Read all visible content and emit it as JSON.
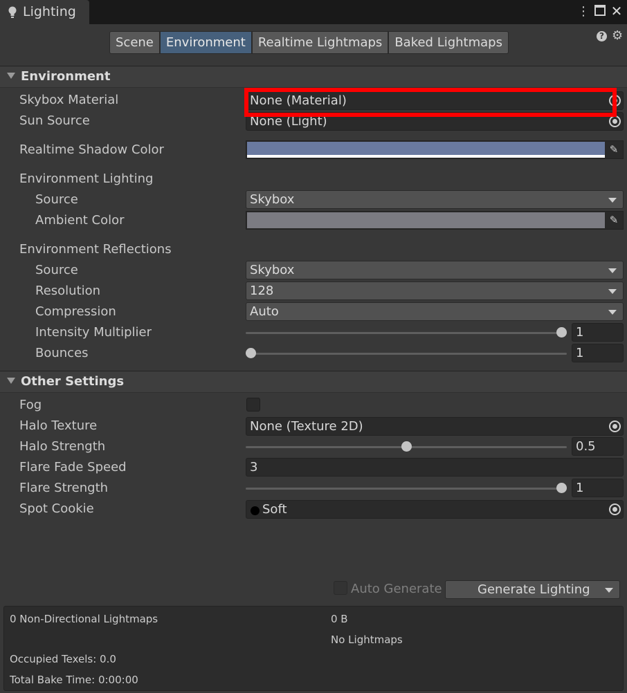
{
  "window": {
    "tab_title": "Lighting",
    "icons": [
      "lightbulb-icon",
      "kebab-menu-icon",
      "maximize-icon",
      "close-icon"
    ]
  },
  "toolbar": {
    "tabs": [
      "Scene",
      "Environment",
      "Realtime Lightmaps",
      "Baked Lightmaps"
    ],
    "active_tab": "Environment",
    "help_glyph": "?",
    "settings_glyph": "⚙"
  },
  "environment": {
    "header": "Environment",
    "skybox_material": {
      "label": "Skybox Material",
      "value": "None (Material)"
    },
    "sun_source": {
      "label": "Sun Source",
      "value": "None (Light)"
    },
    "realtime_shadow_color": {
      "label": "Realtime Shadow Color",
      "color": "#6a7aa0"
    },
    "environment_lighting": {
      "label": "Environment Lighting",
      "source": {
        "label": "Source",
        "value": "Skybox"
      },
      "ambient_color": {
        "label": "Ambient Color",
        "color": "#7b7b82"
      }
    },
    "environment_reflections": {
      "label": "Environment Reflections",
      "source": {
        "label": "Source",
        "value": "Skybox"
      },
      "resolution": {
        "label": "Resolution",
        "value": "128"
      },
      "compression": {
        "label": "Compression",
        "value": "Auto"
      },
      "intensity_multiplier": {
        "label": "Intensity Multiplier",
        "value": "1",
        "fraction": 1.0
      },
      "bounces": {
        "label": "Bounces",
        "value": "1",
        "fraction": 0.0
      }
    }
  },
  "other_settings": {
    "header": "Other Settings",
    "fog": {
      "label": "Fog",
      "checked": false
    },
    "halo_texture": {
      "label": "Halo Texture",
      "value": "None (Texture 2D)"
    },
    "halo_strength": {
      "label": "Halo Strength",
      "value": "0.5",
      "fraction": 0.5
    },
    "flare_fade_speed": {
      "label": "Flare Fade Speed",
      "value": "3"
    },
    "flare_strength": {
      "label": "Flare Strength",
      "value": "1",
      "fraction": 1.0
    },
    "spot_cookie": {
      "label": "Spot Cookie",
      "value": "Soft"
    }
  },
  "bake": {
    "auto_generate": {
      "label": "Auto Generate",
      "checked": false
    },
    "generate_button": "Generate Lighting"
  },
  "stats": {
    "lightmaps": "0 Non-Directional Lightmaps",
    "size": "0 B",
    "no_lightmaps": "No Lightmaps",
    "occupied_texels": "Occupied Texels: 0.0",
    "total_bake_time": "Total Bake Time: 0:00:00"
  },
  "accent": {
    "highlight": "#ff0000",
    "active_tab": "#46607c"
  }
}
